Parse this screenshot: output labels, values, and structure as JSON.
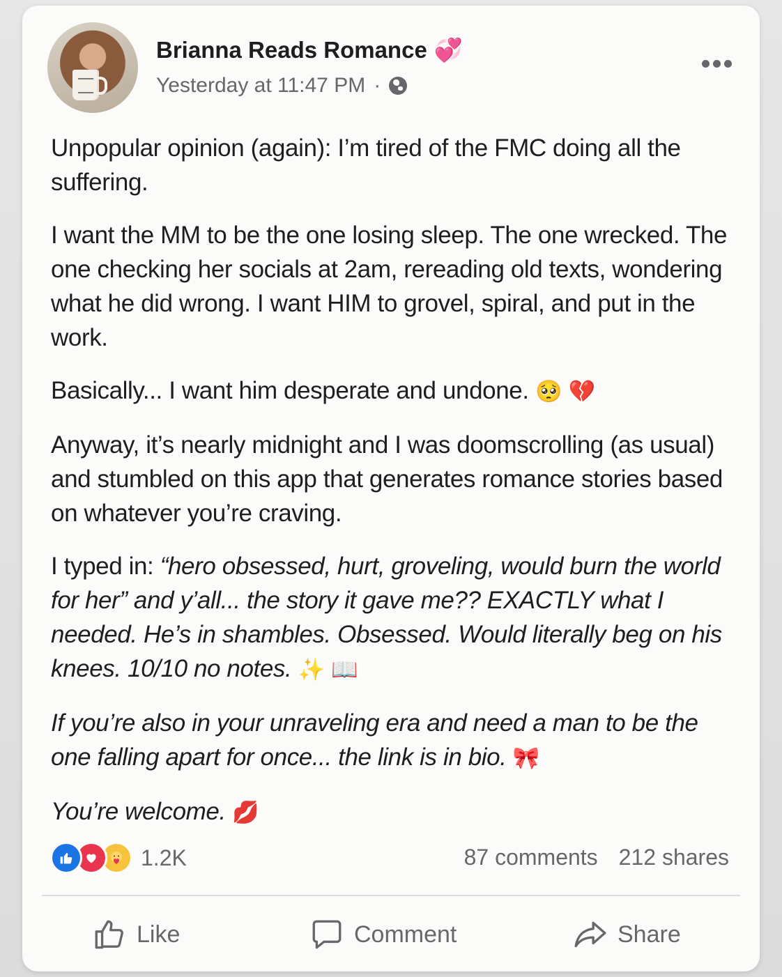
{
  "header": {
    "author_name": "Brianna Reads Romance",
    "author_emoji": "💞",
    "timestamp": "Yesterday at 11:47 PM",
    "separator": "·",
    "privacy_icon": "globe-icon",
    "more_icon": "more-options-icon"
  },
  "post": {
    "p1": "Unpopular opinion (again): I’m tired of the FMC  doing all the suffering.",
    "p2": "I want the MM to be the one losing sleep. The one wrecked. The one checking her socials at 2am, rereading old texts, wondering what he did wrong. I want HIM to grovel, spiral, and put in the work.",
    "p3_text": "Basically... I want him desperate and undone.",
    "p3_emoji1": "🥺",
    "p3_emoji2": "💔",
    "p4": "Anyway, it’s nearly midnight and I was doomscrolling (as usual) and stumbled on this app that generates romance stories based on whatever you’re craving.",
    "p5_intro": "I typed in: ",
    "p5_italic": "“hero obsessed, hurt, groveling, would burn the world for her” and y’all... the story it gave me?? EXACTLY what I needed. He’s in shambles. Obsessed. Would literally beg on his knees. 10/10 no notes.",
    "p5_emoji1": "✨",
    "p5_emoji2": "📖",
    "p6_italic": "If you’re also in your unraveling era and need a man to be the one falling apart for once... the link is in bio.",
    "p6_emoji": "🎀",
    "p7_italic": "You’re welcome.",
    "p7_emoji": "💋"
  },
  "reactions": {
    "count": "1.2K",
    "icons": [
      "like-reaction-icon",
      "love-reaction-icon",
      "care-reaction-icon"
    ]
  },
  "stats": {
    "comments": "87 comments",
    "shares": "212 shares"
  },
  "actions": {
    "like_label": "Like",
    "comment_label": "Comment",
    "share_label": "Share"
  },
  "colors": {
    "text": "#1c1e21",
    "secondary": "#65676b",
    "like_blue": "#1b74e4",
    "love_red": "#e8344e",
    "care_yellow": "#f7c33c"
  }
}
